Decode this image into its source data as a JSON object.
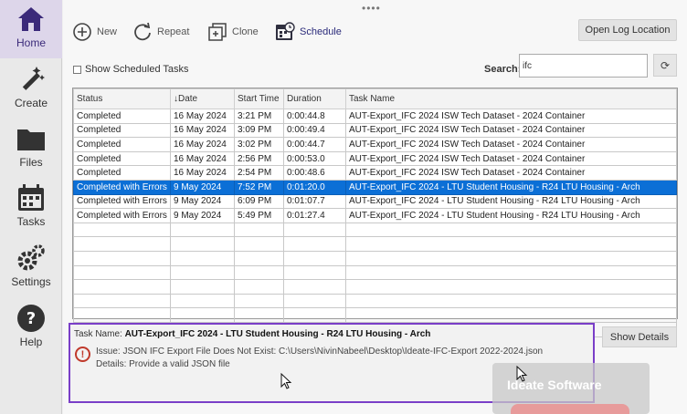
{
  "sidebar": {
    "items": [
      {
        "label": "Home",
        "icon": "home-icon",
        "active": true
      },
      {
        "label": "Create",
        "icon": "magic-wand-icon",
        "active": false
      },
      {
        "label": "Files",
        "icon": "folder-icon",
        "active": false
      },
      {
        "label": "Tasks",
        "icon": "calendar-icon",
        "active": false
      },
      {
        "label": "Settings",
        "icon": "gear-icon",
        "active": false
      },
      {
        "label": "Help",
        "icon": "help-icon",
        "active": false
      }
    ]
  },
  "toolbar": {
    "new_label": "New",
    "repeat_label": "Repeat",
    "clone_label": "Clone",
    "schedule_label": "Schedule",
    "open_log_label": "Open Log Location"
  },
  "filters": {
    "show_scheduled_label": "Show Scheduled Tasks",
    "search_label": "Search:",
    "search_value": "ifc"
  },
  "grid": {
    "columns": [
      "Status",
      "Date",
      "Start Time",
      "Duration",
      "Task Name"
    ],
    "rows": [
      {
        "status": "Completed",
        "date": "16 May 2024",
        "start": "3:21 PM",
        "duration": "0:00:44.8",
        "task": "AUT-Export_IFC 2024 ISW Tech Dataset - 2024 Container"
      },
      {
        "status": "Completed",
        "date": "16 May 2024",
        "start": "3:09 PM",
        "duration": "0:00:49.4",
        "task": "AUT-Export_IFC 2024 ISW Tech Dataset - 2024 Container"
      },
      {
        "status": "Completed",
        "date": "16 May 2024",
        "start": "3:02 PM",
        "duration": "0:00:44.7",
        "task": "AUT-Export_IFC 2024 ISW Tech Dataset - 2024 Container"
      },
      {
        "status": "Completed",
        "date": "16 May 2024",
        "start": "2:56 PM",
        "duration": "0:00:53.0",
        "task": "AUT-Export_IFC 2024 ISW Tech Dataset - 2024 Container"
      },
      {
        "status": "Completed",
        "date": "16 May 2024",
        "start": "2:54 PM",
        "duration": "0:00:48.6",
        "task": "AUT-Export_IFC 2024 ISW Tech Dataset - 2024 Container"
      },
      {
        "status": "Completed with Errors",
        "date": "9 May 2024",
        "start": "7:52 PM",
        "duration": "0:01:20.0",
        "task": "AUT-Export_IFC 2024 - LTU Student Housing - R24 LTU Housing - Arch"
      },
      {
        "status": "Completed with Errors",
        "date": "9 May 2024",
        "start": "6:09 PM",
        "duration": "0:01:07.7",
        "task": "AUT-Export_IFC 2024 - LTU Student Housing - R24 LTU Housing - Arch"
      },
      {
        "status": "Completed with Errors",
        "date": "9 May 2024",
        "start": "5:49 PM",
        "duration": "0:01:27.4",
        "task": "AUT-Export_IFC 2024 - LTU Student Housing - R24 LTU Housing - Arch"
      }
    ],
    "selected_index": 5
  },
  "detail": {
    "task_prefix": "Task Name:",
    "task_name": "AUT-Export_IFC 2024 - LTU Student Housing - R24 LTU Housing - Arch",
    "issue": "Issue: JSON IFC Export File Does Not Exist: C:\\Users\\NivinNabeel\\Desktop\\Ideate-IFC-Export 2022-2024.json",
    "details": "Details: Provide a valid JSON file",
    "show_details_label": "Show Details"
  },
  "watermark": {
    "text": "Ideate Software"
  },
  "colors": {
    "selection": "#0b6fd6",
    "highlight_border": "#7a3fc8",
    "error": "#c0392b",
    "brand": "#3b2a7a"
  }
}
